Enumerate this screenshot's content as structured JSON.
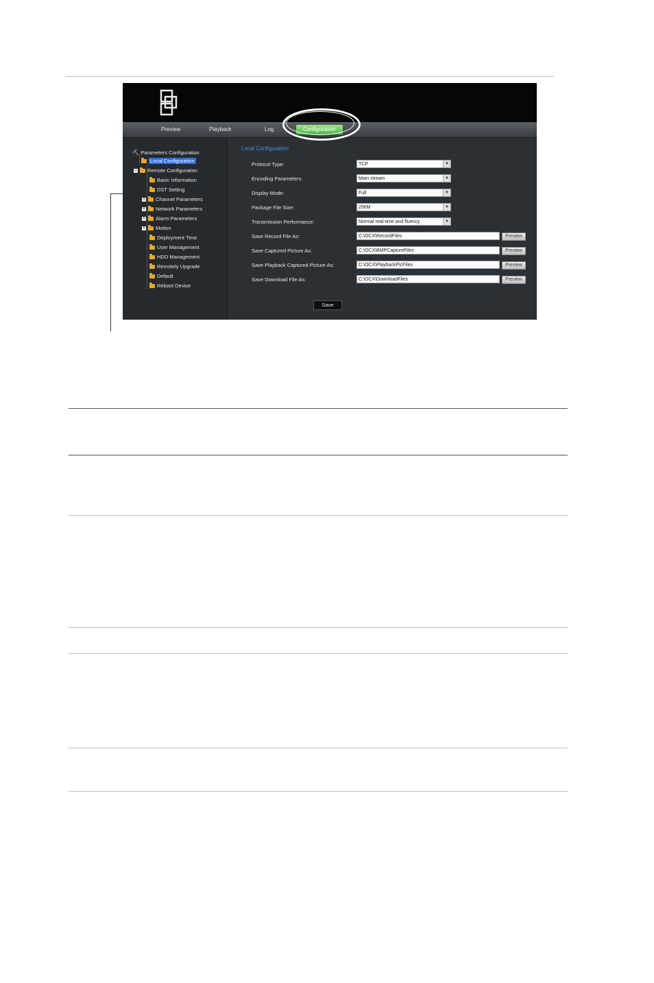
{
  "nav": {
    "tabs": [
      {
        "label": "Preview"
      },
      {
        "label": "Playback"
      },
      {
        "label": "Log"
      },
      {
        "label": "Configuration"
      }
    ]
  },
  "tree": {
    "root": "Parameters Configuration",
    "items": [
      {
        "label": "Local Configuration"
      },
      {
        "label": "Remote Configuration"
      },
      {
        "label": "Basic Information"
      },
      {
        "label": "DST Setting"
      },
      {
        "label": "Channel Parameters"
      },
      {
        "label": "Network Parameters"
      },
      {
        "label": "Alarm Parameters"
      },
      {
        "label": "Motion"
      },
      {
        "label": "Deployment Time"
      },
      {
        "label": "User Management"
      },
      {
        "label": "HDD Management"
      },
      {
        "label": "Remotely Upgrade"
      },
      {
        "label": "Default"
      },
      {
        "label": "Reboot Device"
      }
    ]
  },
  "content": {
    "title": "Local Configuration",
    "fields": [
      {
        "label": "Protocol Type:",
        "value": "TCP"
      },
      {
        "label": "Encoding Parameters:",
        "value": "Main stream"
      },
      {
        "label": "Display Mode:",
        "value": "Full"
      },
      {
        "label": "Package File Size:",
        "value": "256M"
      },
      {
        "label": "Transmission Performance:",
        "value": "Normal real-time and fluency"
      },
      {
        "label": "Save Record File As:",
        "value": "C:\\OCX\\RecordFiles",
        "button": "Preview"
      },
      {
        "label": "Save Captured Picture As:",
        "value": "C:\\OCX\\BMPCaptureFiles",
        "button": "Preview"
      },
      {
        "label": "Save Playback Captured Picture As:",
        "value": "C:\\OCX\\PlaybackPicFiles",
        "button": "Preview"
      },
      {
        "label": "Save Download File As:",
        "value": "C:\\OCX\\DownloadFiles",
        "button": "Preview"
      }
    ],
    "save_label": "Save"
  }
}
